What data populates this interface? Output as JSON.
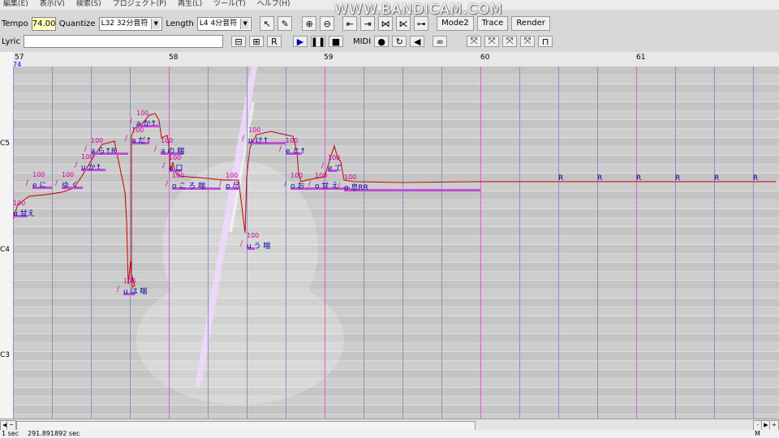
{
  "menu": [
    "編集(E)",
    "表示(V)",
    "検索(S)",
    "プロジェクト(P)",
    "再生(L)",
    "ツール(T)",
    "ヘルプ(H)"
  ],
  "watermark": "WWW.BANDICAM.COM",
  "toolbar": {
    "tempo_label": "Tempo",
    "tempo_value": "74.00",
    "quantize_label": "Quantize",
    "quantize_value": "L32 32分音符",
    "length_label": "Length",
    "length_value": "L4  4分音符",
    "mode2": "Mode2",
    "trace": "Trace",
    "render": "Render",
    "lyric_label": "Lyric",
    "midi_label": "MIDI"
  },
  "ruler": {
    "measures": [
      "57",
      "58",
      "59",
      "60",
      "61"
    ],
    "tempo": "74"
  },
  "octaves": [
    "C5",
    "C4",
    "C3"
  ],
  "notes": {
    "velocity": "100",
    "lyrics": [
      "u 甘え",
      "e に",
      "ゆ く",
      "u か↑",
      "a ら↑R",
      "u は 喘",
      "a だ↑",
      "a か↑",
      "a の 喘",
      "o 口",
      "o こ ろ 喘",
      "o 尽",
      "u け↑",
      "u う 喘",
      "e と↑",
      "o お",
      "o 甘 え",
      "e て",
      "o 息RR"
    ],
    "rests": [
      "R",
      "R",
      "R",
      "R",
      "R",
      "R"
    ]
  },
  "status": {
    "left": "1 sec",
    "time": "291.891892 sec",
    "right": "M"
  }
}
